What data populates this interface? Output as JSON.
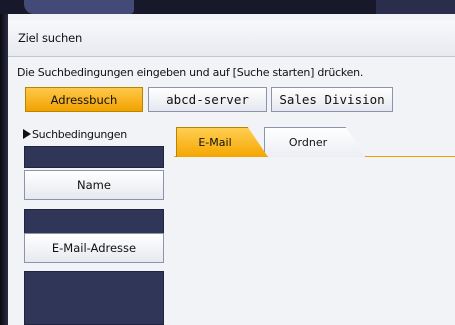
{
  "header": {
    "title": "Ziel suchen"
  },
  "instruction": "Die Suchbedingungen eingeben und auf [Suche starten] drücken.",
  "address_books": [
    {
      "label": "Adressbuch",
      "active": true
    },
    {
      "label": "abcd-server",
      "active": false
    },
    {
      "label": "Sales Division",
      "active": false
    }
  ],
  "criteria": {
    "label": "Suchbedingungen",
    "fields": [
      {
        "label": "Name"
      },
      {
        "label": "E-Mail-Adresse"
      }
    ]
  },
  "tabs": [
    {
      "label": "E-Mail",
      "active": true
    },
    {
      "label": "Ordner",
      "active": false
    }
  ],
  "colors": {
    "accent": "#f4a600",
    "navy": "#2f3658",
    "background": "#f2f3f6"
  }
}
